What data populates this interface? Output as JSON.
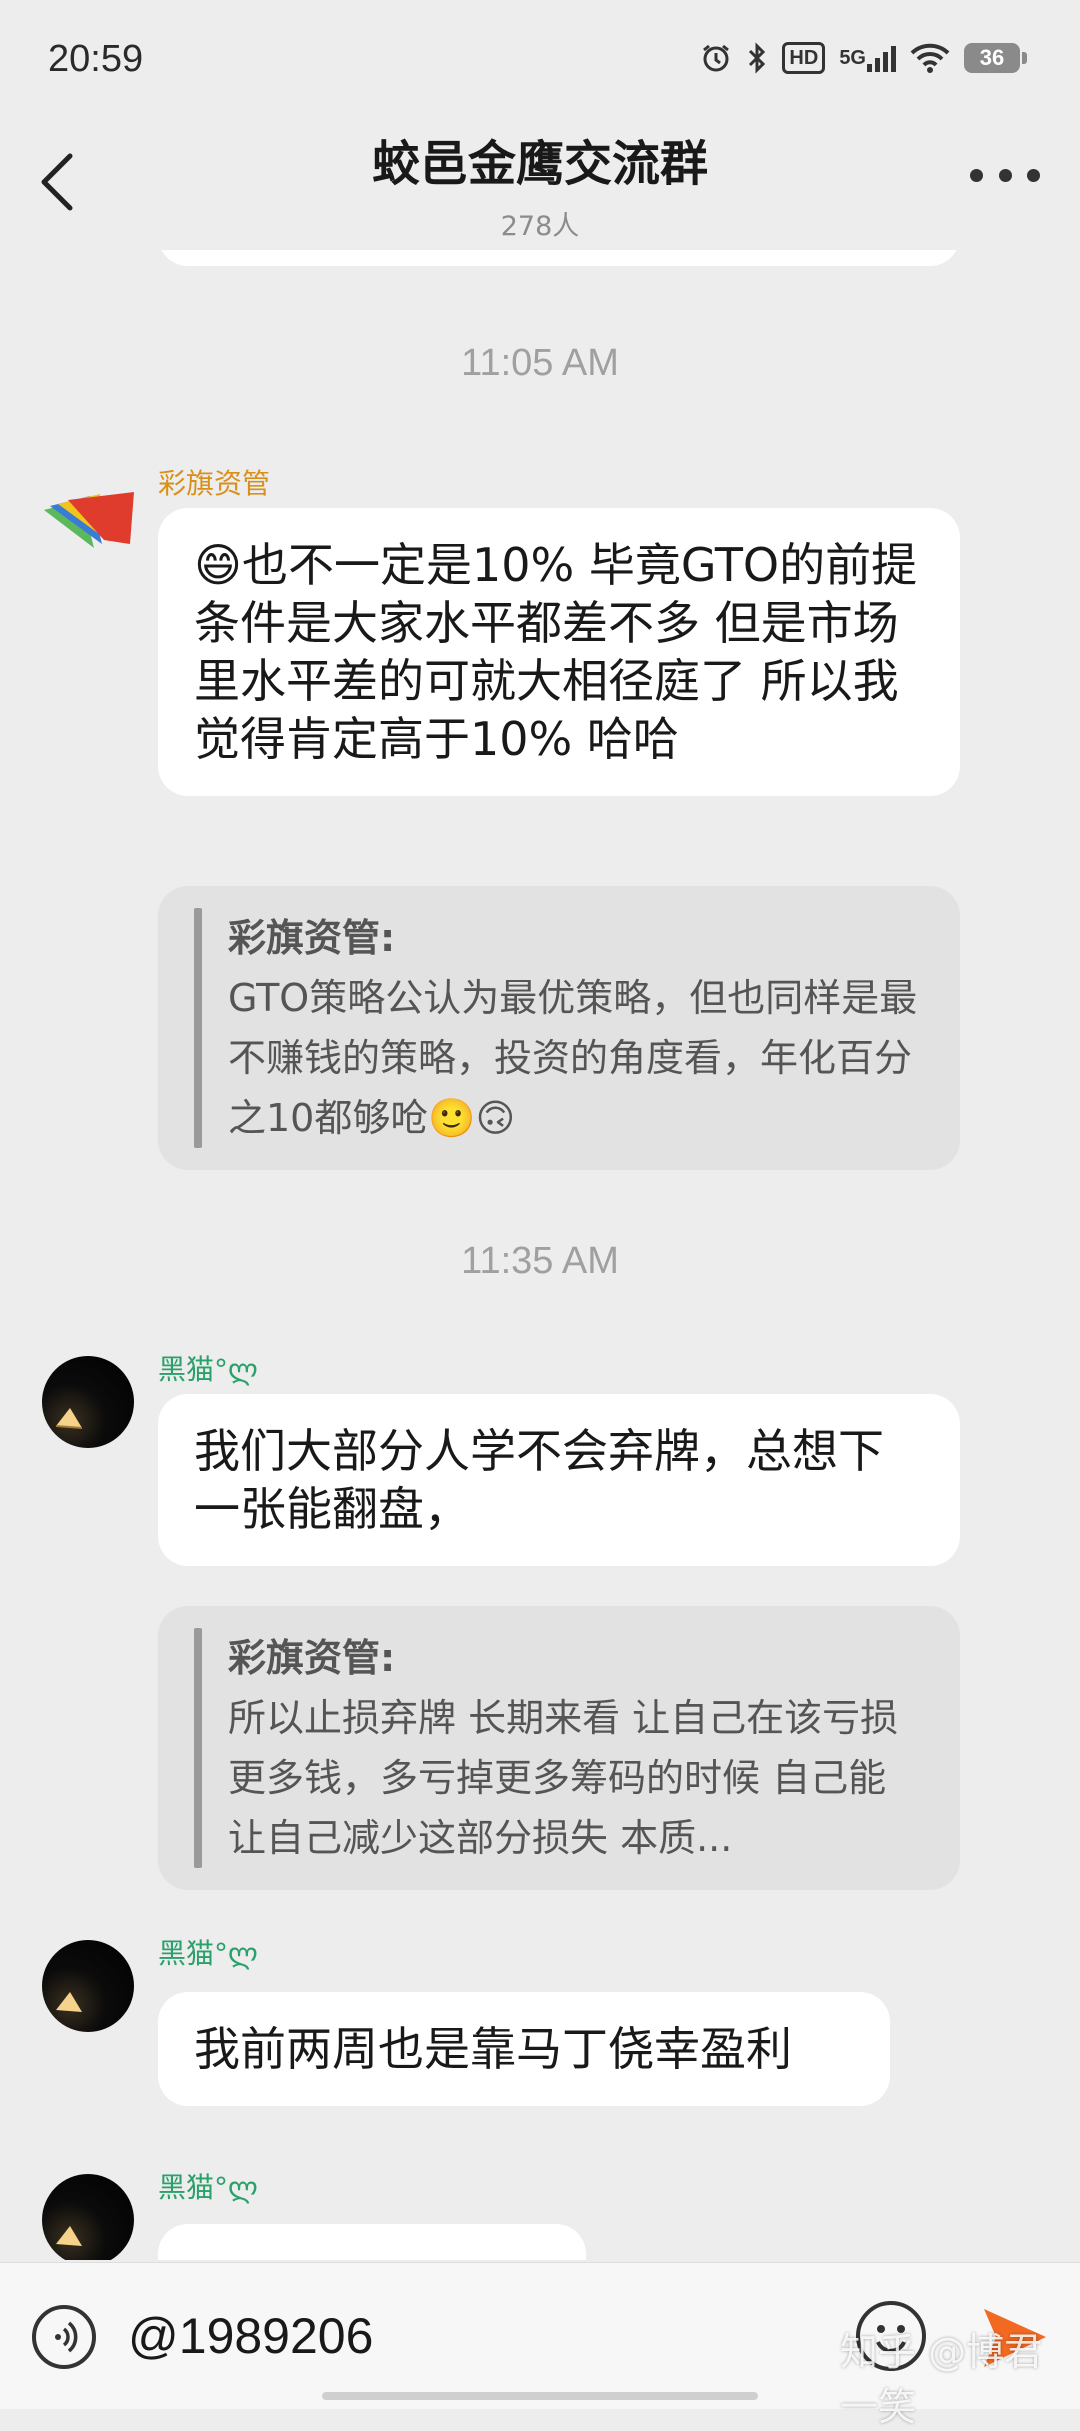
{
  "status": {
    "time": "20:59",
    "hd": "HD",
    "signal": "5G",
    "battery": "36"
  },
  "header": {
    "title": "蛟邑金鹰交流群",
    "member_count": "278人"
  },
  "chat": {
    "timestamp_1": "11:05 AM",
    "msg1": {
      "sender": "彩旗资管",
      "text": "😄也不一定是10% 毕竟GTO的前提条件是大家水平都差不多 但是市场里水平差的可就大相径庭了 所以我觉得肯定高于10% 哈哈",
      "quote_author": "彩旗资管:",
      "quote_text": "GTO策略公认为最优策略，但也同样是最不赚钱的策略，投资的角度看，年化百分之10都够呛🙂🙃"
    },
    "timestamp_2": "11:35 AM",
    "msg2": {
      "sender": "黑猫°ლ",
      "text": "我们大部分人学不会弃牌，总想下一张能翻盘，",
      "quote_author": "彩旗资管:",
      "quote_text": "所以止损弃牌 长期来看 让自己在该亏损更多钱，多亏掉更多筹码的时候 自己能让自己减少这部分损失 本质..."
    },
    "msg3": {
      "sender": "黑猫°ლ",
      "text": "我前两周也是靠马丁侥幸盈利"
    },
    "msg4": {
      "sender": "黑猫°ლ"
    }
  },
  "input": {
    "value": "@1989206",
    "watermark": "知乎 @博君一笑"
  }
}
